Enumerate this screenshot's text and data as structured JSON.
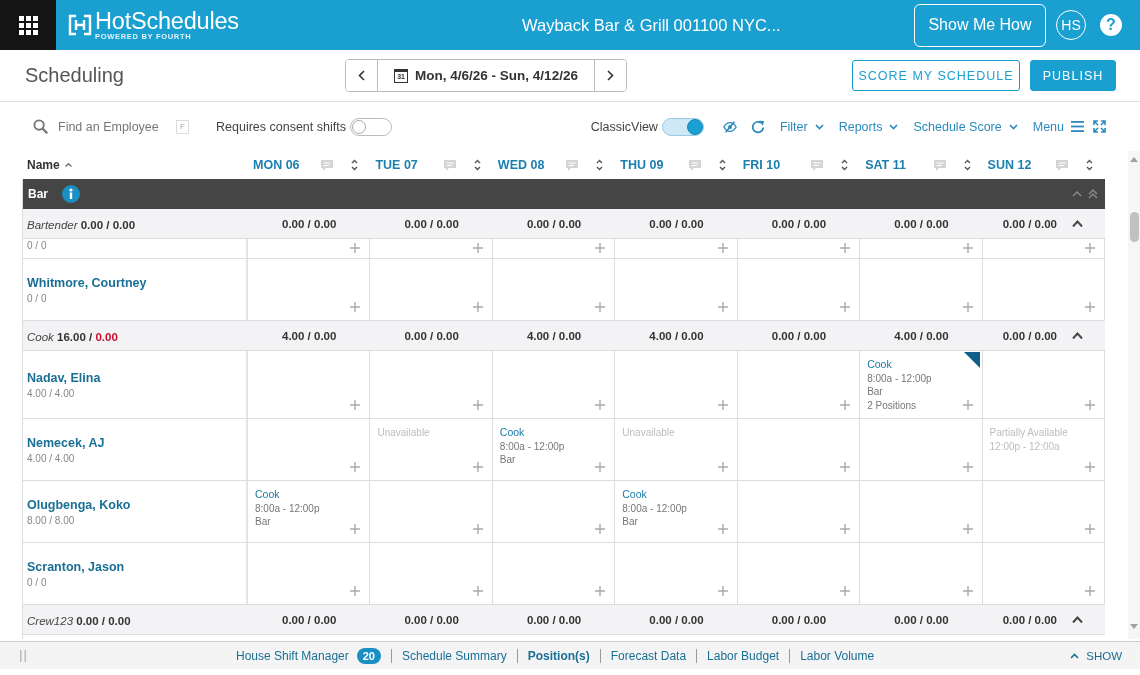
{
  "header": {
    "brand": "HotSchedules",
    "tagline": "POWERED BY FOURTH",
    "location": "Wayback Bar & Grill 001100 NYC...",
    "guide_button": "Show Me How",
    "avatar": "HS",
    "help": "?"
  },
  "page": {
    "title": "Scheduling",
    "calendar_day": "31",
    "date_range": "Mon, 4/6/26 - Sun, 4/12/26",
    "actions": [
      {
        "label": "SCORE MY SCHEDULE",
        "kind": "outline"
      },
      {
        "label": "PUBLISH",
        "kind": "primary"
      }
    ]
  },
  "toolbar": {
    "search": {
      "placeholder": "Find an Employee",
      "shortcut": "F"
    },
    "consent_toggle": {
      "label": "Requires consent shifts",
      "on": false
    },
    "classic_view_toggle": {
      "label": "ClassicView",
      "on": true
    },
    "dropdowns": [
      "Filter",
      "Reports",
      "Schedule Score"
    ],
    "menu": "Menu"
  },
  "grid": {
    "name_header": "Name",
    "days": [
      "MON 06",
      "TUE 07",
      "WED 08",
      "THU 09",
      "FRI 10",
      "SAT 11",
      "SUN 12"
    ],
    "sections": [
      {
        "name": "Bar",
        "positions": [
          {
            "name": "Bartender",
            "scheduled": "0.00 /",
            "budget": "0.00",
            "over_budget": false,
            "expanded": true,
            "day_totals": [
              "0.00 / 0.00",
              "0.00 / 0.00",
              "0.00 / 0.00",
              "0.00 / 0.00",
              "0.00 / 0.00",
              "0.00 / 0.00",
              "0.00 / 0.00"
            ],
            "employees": [
              {
                "hours": "0 / 0",
                "cells": [
                  {
                    "kind": "empty"
                  },
                  {
                    "kind": "empty"
                  },
                  {
                    "kind": "empty"
                  },
                  {
                    "kind": "empty"
                  },
                  {
                    "kind": "empty"
                  },
                  {
                    "kind": "empty"
                  },
                  {
                    "kind": "empty"
                  }
                ]
              },
              {
                "name": "Whitmore, Courtney",
                "hours": "0 / 0",
                "cells": [
                  {
                    "kind": "empty"
                  },
                  {
                    "kind": "empty"
                  },
                  {
                    "kind": "empty"
                  },
                  {
                    "kind": "empty"
                  },
                  {
                    "kind": "empty"
                  },
                  {
                    "kind": "empty"
                  },
                  {
                    "kind": "empty"
                  }
                ]
              }
            ]
          },
          {
            "name": "Cook",
            "scheduled": "16.00 /",
            "budget": "0.00",
            "over_budget": true,
            "expanded": true,
            "day_totals": [
              "4.00 / 0.00",
              "0.00 / 0.00",
              "4.00 / 0.00",
              "4.00 / 0.00",
              "0.00 / 0.00",
              "4.00 / 0.00",
              "0.00 / 0.00"
            ],
            "employees": [
              {
                "name": "Nadav, Elina",
                "hours": "4.00 / 4.00",
                "cells": [
                  {
                    "kind": "empty"
                  },
                  {
                    "kind": "empty"
                  },
                  {
                    "kind": "empty"
                  },
                  {
                    "kind": "empty"
                  },
                  {
                    "kind": "empty"
                  },
                  {
                    "kind": "shift",
                    "position": "Cook",
                    "time": "8:00a - 12:00p",
                    "location": "Bar",
                    "note": "2 Positions",
                    "flagged": true
                  },
                  {
                    "kind": "empty"
                  }
                ]
              },
              {
                "name": "Nemecek, AJ",
                "hours": "4.00 / 4.00",
                "cells": [
                  {
                    "kind": "empty"
                  },
                  {
                    "kind": "unavailable",
                    "label": "Unavailable"
                  },
                  {
                    "kind": "shift",
                    "position": "Cook",
                    "time": "8:00a - 12:00p",
                    "location": "Bar",
                    "flagged": false
                  },
                  {
                    "kind": "unavailable",
                    "label": "Unavailable"
                  },
                  {
                    "kind": "empty"
                  },
                  {
                    "kind": "empty"
                  },
                  {
                    "kind": "partial",
                    "label": "Partially Available",
                    "time": "12:00p - 12:00a"
                  }
                ]
              },
              {
                "name": "Olugbenga, Koko",
                "hours": "8.00 / 8.00",
                "cells": [
                  {
                    "kind": "shift",
                    "position": "Cook",
                    "time": "8:00a - 12:00p",
                    "location": "Bar",
                    "flagged": false
                  },
                  {
                    "kind": "empty"
                  },
                  {
                    "kind": "empty"
                  },
                  {
                    "kind": "shift",
                    "position": "Cook",
                    "time": "8:00a - 12:00p",
                    "location": "Bar",
                    "flagged": false
                  },
                  {
                    "kind": "empty"
                  },
                  {
                    "kind": "empty"
                  },
                  {
                    "kind": "empty"
                  }
                ]
              },
              {
                "name": "Scranton, Jason",
                "hours": "0 / 0",
                "cells": [
                  {
                    "kind": "empty"
                  },
                  {
                    "kind": "empty"
                  },
                  {
                    "kind": "empty"
                  },
                  {
                    "kind": "empty"
                  },
                  {
                    "kind": "empty"
                  },
                  {
                    "kind": "empty"
                  },
                  {
                    "kind": "empty"
                  }
                ]
              }
            ]
          },
          {
            "name": "Crew123",
            "scheduled": "0.00 /",
            "budget": "0.00",
            "over_budget": false,
            "expanded": true,
            "day_totals": [
              "0.00 / 0.00",
              "0.00 / 0.00",
              "0.00 / 0.00",
              "0.00 / 0.00",
              "0.00 / 0.00",
              "0.00 / 0.00",
              "0.00 / 0.00"
            ]
          }
        ]
      }
    ]
  },
  "bottom_bar": {
    "tabs": [
      {
        "label": "House Shift Manager",
        "badge": "20",
        "selected": false
      },
      {
        "label": "Schedule Summary",
        "selected": false
      },
      {
        "label": "Position(s)",
        "selected": true
      },
      {
        "label": "Forecast Data",
        "selected": false
      },
      {
        "label": "Labor Budget",
        "selected": false
      },
      {
        "label": "Labor Volume",
        "selected": false
      }
    ],
    "show": "SHOW"
  }
}
